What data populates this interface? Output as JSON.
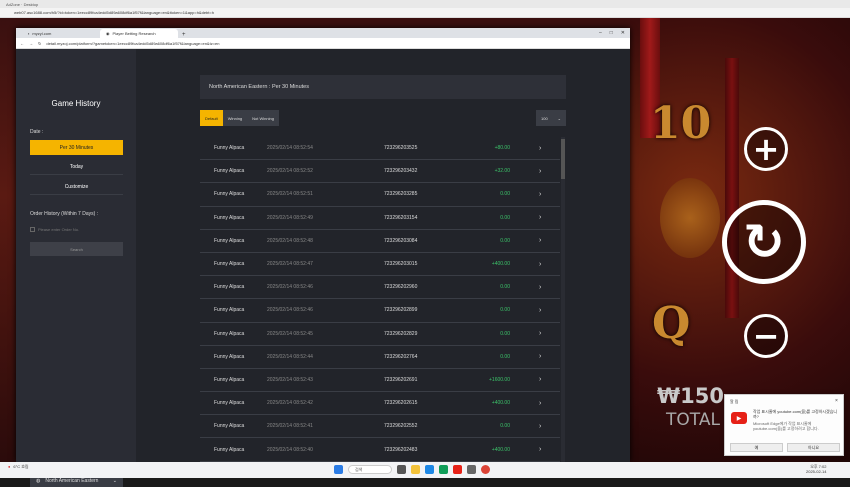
{
  "outer_browser": {
    "tab_text": "AdZone · Desktop",
    "address": "web07.asc1688.com/h5/?id=token=1eecc89fca4edd5d89a608df6a1f57f&language=en&ttoken=1&app=h&debt=h"
  },
  "browser": {
    "tabs": [
      {
        "label": "myzyl.com"
      },
      {
        "label": "Player Betting Research"
      }
    ],
    "new_tab": "+",
    "address": "detail.myzoj.com/platform/?gametoken=1eecc89fca4edd5d89a608df6a1f57f&language=en&tz=en"
  },
  "sidebar": {
    "title": "Game History",
    "date_label": "Date :",
    "buttons": [
      "Per 30 Minutes",
      "Today",
      "Customize"
    ],
    "order_label": "Order History (Within 7 Days) :",
    "checkbox_label": "Please enter Order No.",
    "search_label": "Search",
    "region": "North American Eastern",
    "region_caret": "⌄"
  },
  "main": {
    "timezone_bar": "North American Eastern : Per 30 Minutes",
    "filters": [
      "Default",
      "Winning",
      "Not Winning"
    ],
    "page_size": "100",
    "rows": [
      {
        "name": "Funny Alpaca",
        "time": "2025/02/14 08:52:54",
        "id": "723296203525",
        "amount": "+80.00"
      },
      {
        "name": "Funny Alpaca",
        "time": "2025/02/14 08:52:52",
        "id": "723296203432",
        "amount": "+32.00"
      },
      {
        "name": "Funny Alpaca",
        "time": "2025/02/14 08:52:51",
        "id": "723296203285",
        "amount": "0.00"
      },
      {
        "name": "Funny Alpaca",
        "time": "2025/02/14 08:52:49",
        "id": "723296203154",
        "amount": "0.00"
      },
      {
        "name": "Funny Alpaca",
        "time": "2025/02/14 08:52:48",
        "id": "723296203084",
        "amount": "0.00"
      },
      {
        "name": "Funny Alpaca",
        "time": "2025/02/14 08:52:47",
        "id": "723296203015",
        "amount": "+400.00"
      },
      {
        "name": "Funny Alpaca",
        "time": "2025/02/14 08:52:46",
        "id": "723296202960",
        "amount": "0.00"
      },
      {
        "name": "Funny Alpaca",
        "time": "2025/02/14 08:52:46",
        "id": "723296202899",
        "amount": "0.00"
      },
      {
        "name": "Funny Alpaca",
        "time": "2025/02/14 08:52:45",
        "id": "723296202829",
        "amount": "0.00"
      },
      {
        "name": "Funny Alpaca",
        "time": "2025/02/14 08:52:44",
        "id": "723296202764",
        "amount": "0.00"
      },
      {
        "name": "Funny Alpaca",
        "time": "2025/02/14 08:52:43",
        "id": "723296202691",
        "amount": "+1600.00"
      },
      {
        "name": "Funny Alpaca",
        "time": "2025/02/14 08:52:42",
        "id": "723296202615",
        "amount": "+400.00"
      },
      {
        "name": "Funny Alpaca",
        "time": "2025/02/14 08:52:41",
        "id": "723296202552",
        "amount": "0.00"
      },
      {
        "name": "Funny Alpaca",
        "time": "2025/02/14 08:52:40",
        "id": "723296202483",
        "amount": "+400.00"
      }
    ]
  },
  "game": {
    "win": "₩150",
    "total": "TOTAL",
    "plus": "+",
    "minus": "−",
    "spin": "↻",
    "symbols": [
      "10",
      "Q"
    ]
  },
  "taskbar": {
    "weather": "6°C 흐림",
    "search": "검색",
    "time": "오후 7:02",
    "date": "2025-02-14"
  },
  "toast": {
    "header": "알 림",
    "close": "×",
    "message": "작업 표시줄에 youtube.com(을)를 고정하시겠습니까?",
    "sub": "Microsoft Edge에가 작업 표시줄에 youtube.com(을)를 고정하려고 합니다.",
    "yes": "예",
    "no": "아니요"
  }
}
